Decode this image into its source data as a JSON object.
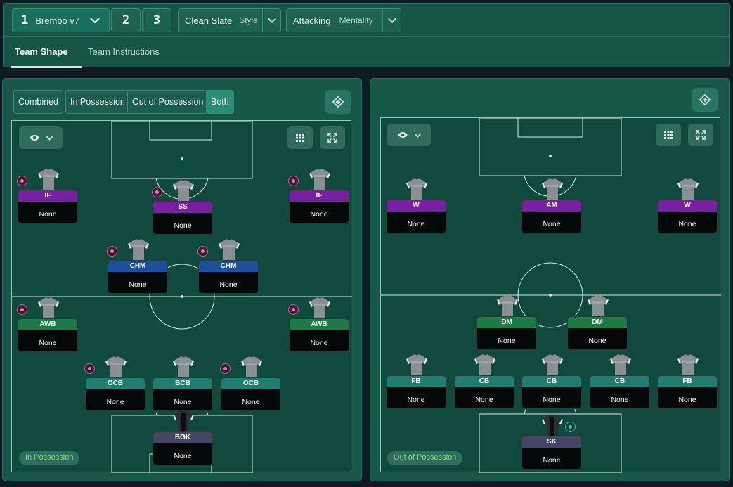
{
  "tactics": {
    "slot1": {
      "num": "1",
      "name": "Brembo v7"
    },
    "slot2": "2",
    "slot3": "3",
    "style": {
      "value": "Clean Slate",
      "label": "Style"
    },
    "mentality": {
      "value": "Attacking",
      "label": "Mentality"
    }
  },
  "tabs": [
    {
      "label": "Team Shape",
      "active": true
    },
    {
      "label": "Team Instructions",
      "active": false
    }
  ],
  "filters": [
    "Combined",
    "In Possession",
    "Out of Possession",
    "Both"
  ],
  "filter_active": "Both",
  "colors": {
    "attack": "#7a1fa2",
    "midfield": "#1d4f9a",
    "wingback": "#1e7a44",
    "defence": "#1f7d72",
    "keeper": "#454566"
  },
  "left_panel": {
    "phase_label": "In Possession",
    "players": [
      {
        "role": "IF",
        "name": "None",
        "color": "#7a1fa2",
        "badge": true
      },
      {
        "role": "SS",
        "name": "None",
        "color": "#7a1fa2",
        "badge": true
      },
      {
        "role": "IF",
        "name": "None",
        "color": "#7a1fa2",
        "badge": true
      },
      {
        "role": "CHM",
        "name": "None",
        "color": "#1d4f9a",
        "badge": true
      },
      {
        "role": "CHM",
        "name": "None",
        "color": "#1d4f9a",
        "badge": true
      },
      {
        "role": "AWB",
        "name": "None",
        "color": "#1e7a44",
        "badge": true
      },
      {
        "role": "AWB",
        "name": "None",
        "color": "#1e7a44",
        "badge": true
      },
      {
        "role": "OCB",
        "name": "None",
        "color": "#1f7d72",
        "badge": true
      },
      {
        "role": "BCB",
        "name": "None",
        "color": "#1f7d72",
        "badge": false
      },
      {
        "role": "OCB",
        "name": "None",
        "color": "#1f7d72",
        "badge": true
      },
      {
        "role": "BGK",
        "name": "None",
        "color": "#454566",
        "badge": false,
        "keeper": true
      }
    ]
  },
  "right_panel": {
    "phase_label": "Out of Possession",
    "players": [
      {
        "role": "W",
        "name": "None",
        "color": "#7a1fa2",
        "badge": false
      },
      {
        "role": "AM",
        "name": "None",
        "color": "#7a1fa2",
        "badge": false
      },
      {
        "role": "W",
        "name": "None",
        "color": "#7a1fa2",
        "badge": false
      },
      {
        "role": "DM",
        "name": "None",
        "color": "#1e7a44",
        "badge": false
      },
      {
        "role": "DM",
        "name": "None",
        "color": "#1e7a44",
        "badge": false
      },
      {
        "role": "FB",
        "name": "None",
        "color": "#1f7d72",
        "badge": false
      },
      {
        "role": "CB",
        "name": "None",
        "color": "#1f7d72",
        "badge": false
      },
      {
        "role": "CB",
        "name": "None",
        "color": "#1f7d72",
        "badge": false
      },
      {
        "role": "CB",
        "name": "None",
        "color": "#1f7d72",
        "badge": false
      },
      {
        "role": "FB",
        "name": "None",
        "color": "#1f7d72",
        "badge": false
      },
      {
        "role": "SK",
        "name": "None",
        "color": "#454566",
        "badge": "green",
        "keeper": true
      }
    ]
  },
  "icons": {
    "chevron": "chevron-down-icon",
    "eye": "eye-icon",
    "grid": "grid-icon",
    "expand": "expand-icon",
    "tactic": "tactic-board-icon"
  }
}
